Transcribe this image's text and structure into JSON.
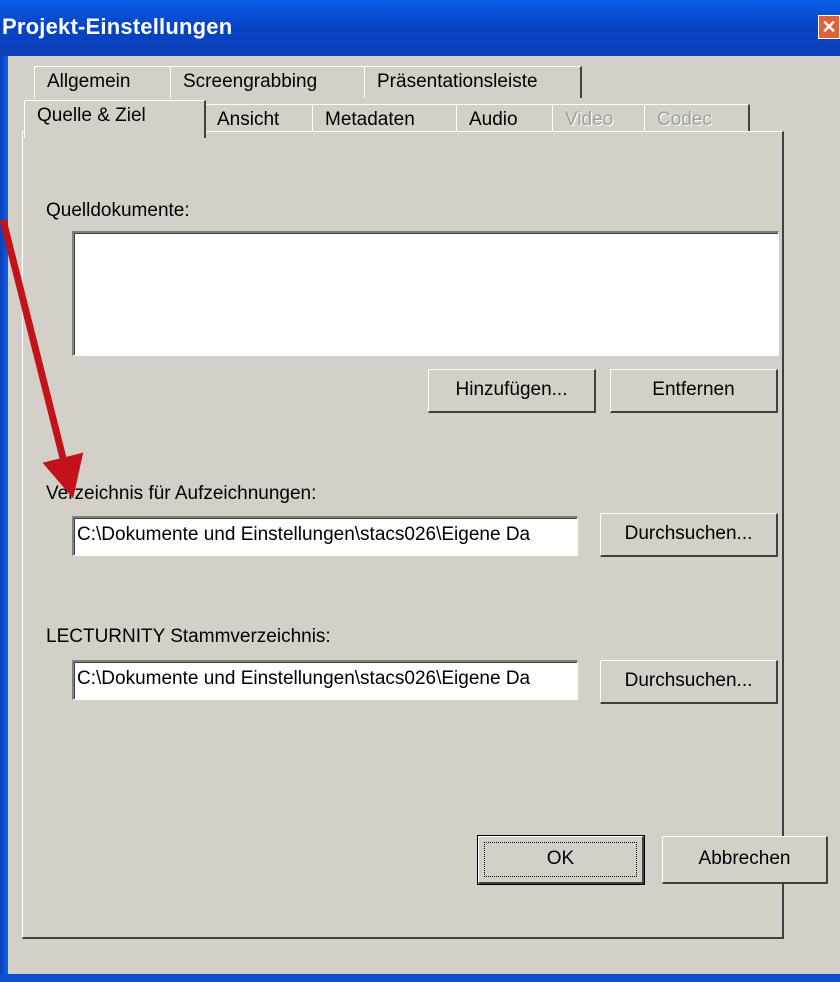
{
  "window": {
    "title": "Projekt-Einstellungen",
    "close_glyph": "✕"
  },
  "tabs_row1": [
    "Allgemein",
    "Screengrabbing",
    "Präsentationsleiste"
  ],
  "tabs_row2": [
    {
      "label": "Quelle & Ziel",
      "active": true
    },
    {
      "label": "Ansicht"
    },
    {
      "label": "Metadaten"
    },
    {
      "label": "Audio"
    },
    {
      "label": "Video",
      "disabled": true
    },
    {
      "label": "Codec",
      "disabled": true
    }
  ],
  "source": {
    "label": "Quelldokumente:",
    "add_button": "Hinzufügen...",
    "remove_button": "Entfernen"
  },
  "recordings": {
    "label": "Verzeichnis für Aufzeichnungen:",
    "path": "C:\\Dokumente und Einstellungen\\stacs026\\Eigene Da",
    "browse_button": "Durchsuchen..."
  },
  "root_dir": {
    "label": "LECTURNITY Stammverzeichnis:",
    "path": "C:\\Dokumente und Einstellungen\\stacs026\\Eigene Da",
    "browse_button": "Durchsuchen..."
  },
  "footer": {
    "ok_button": "OK",
    "cancel_button": "Abbrechen"
  },
  "colors": {
    "titlebar": "#0645c8",
    "face": "#d4d0c8",
    "annotation_arrow": "#c4121a"
  }
}
